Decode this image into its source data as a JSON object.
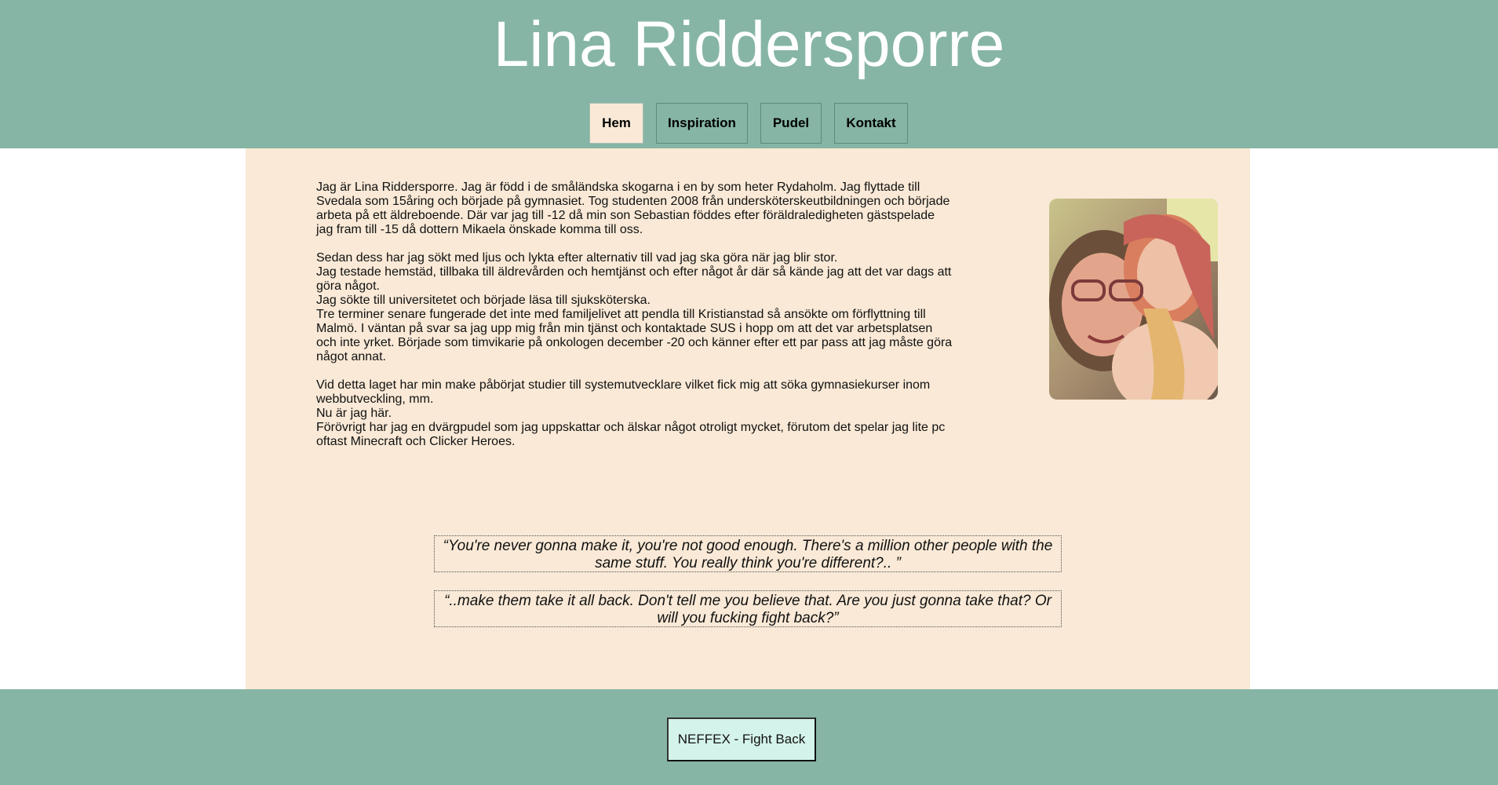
{
  "header": {
    "title": "Lina Riddersporre",
    "nav": [
      "Hem",
      "Inspiration",
      "Pudel",
      "Kontakt"
    ]
  },
  "bio": {
    "p1": "Jag är Lina Riddersporre. Jag är född i de småländska skogarna i en by som heter Rydaholm. Jag flyttade till\nSvedala som 15åring och började på gymnasiet. Tog studenten 2008 från undersköterskeutbildningen och började\narbeta på ett äldreboende. Där var jag till -12 då min son Sebastian föddes efter föräldraledigheten gästspelade\njag fram till -15 då dottern Mikaela önskade komma till oss.",
    "p2": "Sedan dess har jag sökt med ljus och lykta efter alternativ till vad jag ska göra när jag blir stor.\nJag testade hemstäd, tillbaka till äldrevården och hemtjänst och efter något år där så kände jag att det var dags att\ngöra något.\nJag sökte till universitetet och började läsa till sjuksköterska.\nTre terminer senare fungerade det inte med familjelivet att pendla till Kristianstad så ansökte om förflyttning till\nMalmö. I väntan på svar sa jag upp mig från min tjänst och kontaktade SUS i hopp om att det var arbetsplatsen\noch inte yrket. Började som timvikarie på onkologen december -20 och känner efter ett par pass att jag måste göra\nnågot annat.",
    "p3": "Vid detta laget har min make påbörjat studier till systemutvecklare vilket fick mig att söka gymnasiekurser inom\nwebbutveckling, mm.\nNu är jag här.\nFörövrigt har jag en dvärgpudel som jag uppskattar och älskar något otroligt mycket, förutom det spelar jag lite pc\noftast Minecraft och Clicker Heroes."
  },
  "quotes": [
    "“You're never gonna make it, you're not good enough. There's a million other people with the same stuff. You really think you're different?.. ”",
    "“..make them take it all back. Don't tell me you believe that. Are you just gonna take that? Or will you fucking fight back?”"
  ],
  "footer": {
    "music_button": "NEFFEX - Fight Back"
  },
  "colors": {
    "accent": "#86b5a5",
    "content_bg": "#f9e9d6",
    "button_bg": "#d4f3ea"
  }
}
